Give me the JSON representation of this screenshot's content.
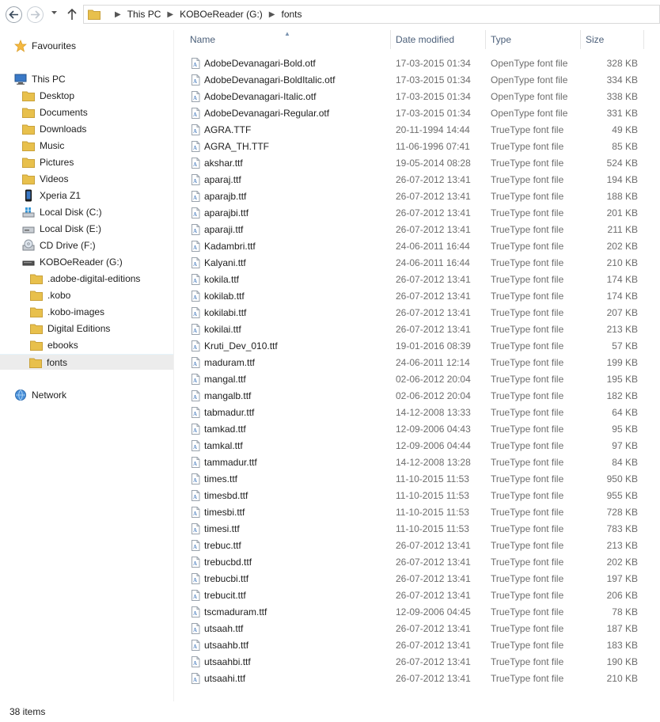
{
  "address": {
    "crumbs": [
      "This PC",
      "KOBOeReader (G:)",
      "fonts"
    ]
  },
  "nav": {
    "favourites": "Favourites",
    "this_pc": "This PC",
    "items": [
      {
        "label": "Desktop",
        "icon": "folder-icon"
      },
      {
        "label": "Documents",
        "icon": "folder-icon"
      },
      {
        "label": "Downloads",
        "icon": "folder-icon"
      },
      {
        "label": "Music",
        "icon": "folder-icon"
      },
      {
        "label": "Pictures",
        "icon": "folder-icon"
      },
      {
        "label": "Videos",
        "icon": "folder-icon"
      },
      {
        "label": "Xperia Z1",
        "icon": "phone-icon"
      },
      {
        "label": "Local Disk (C:)",
        "icon": "windows-drive-icon"
      },
      {
        "label": "Local Disk (E:)",
        "icon": "drive-icon"
      },
      {
        "label": "CD Drive (F:)",
        "icon": "cd-drive-icon"
      },
      {
        "label": "KOBOeReader (G:)",
        "icon": "removable-drive-icon"
      }
    ],
    "kobo_children": [
      {
        "label": ".adobe-digital-editions"
      },
      {
        "label": ".kobo"
      },
      {
        "label": ".kobo-images"
      },
      {
        "label": "Digital Editions"
      },
      {
        "label": "ebooks"
      },
      {
        "label": "fonts"
      }
    ],
    "network": "Network"
  },
  "columns": {
    "name": "Name",
    "date": "Date modified",
    "type": "Type",
    "size": "Size"
  },
  "files": [
    {
      "name": "AdobeDevanagari-Bold.otf",
      "date": "17-03-2015 01:34",
      "type": "OpenType font file",
      "size": "328 KB"
    },
    {
      "name": "AdobeDevanagari-BoldItalic.otf",
      "date": "17-03-2015 01:34",
      "type": "OpenType font file",
      "size": "334 KB"
    },
    {
      "name": "AdobeDevanagari-Italic.otf",
      "date": "17-03-2015 01:34",
      "type": "OpenType font file",
      "size": "338 KB"
    },
    {
      "name": "AdobeDevanagari-Regular.otf",
      "date": "17-03-2015 01:34",
      "type": "OpenType font file",
      "size": "331 KB"
    },
    {
      "name": "AGRA.TTF",
      "date": "20-11-1994 14:44",
      "type": "TrueType font file",
      "size": "49 KB"
    },
    {
      "name": "AGRA_TH.TTF",
      "date": "11-06-1996 07:41",
      "type": "TrueType font file",
      "size": "85 KB"
    },
    {
      "name": "akshar.ttf",
      "date": "19-05-2014 08:28",
      "type": "TrueType font file",
      "size": "524 KB"
    },
    {
      "name": "aparaj.ttf",
      "date": "26-07-2012 13:41",
      "type": "TrueType font file",
      "size": "194 KB"
    },
    {
      "name": "aparajb.ttf",
      "date": "26-07-2012 13:41",
      "type": "TrueType font file",
      "size": "188 KB"
    },
    {
      "name": "aparajbi.ttf",
      "date": "26-07-2012 13:41",
      "type": "TrueType font file",
      "size": "201 KB"
    },
    {
      "name": "aparaji.ttf",
      "date": "26-07-2012 13:41",
      "type": "TrueType font file",
      "size": "211 KB"
    },
    {
      "name": "Kadambri.ttf",
      "date": "24-06-2011 16:44",
      "type": "TrueType font file",
      "size": "202 KB"
    },
    {
      "name": "Kalyani.ttf",
      "date": "24-06-2011 16:44",
      "type": "TrueType font file",
      "size": "210 KB"
    },
    {
      "name": "kokila.ttf",
      "date": "26-07-2012 13:41",
      "type": "TrueType font file",
      "size": "174 KB"
    },
    {
      "name": "kokilab.ttf",
      "date": "26-07-2012 13:41",
      "type": "TrueType font file",
      "size": "174 KB"
    },
    {
      "name": "kokilabi.ttf",
      "date": "26-07-2012 13:41",
      "type": "TrueType font file",
      "size": "207 KB"
    },
    {
      "name": "kokilai.ttf",
      "date": "26-07-2012 13:41",
      "type": "TrueType font file",
      "size": "213 KB"
    },
    {
      "name": "Kruti_Dev_010.ttf",
      "date": "19-01-2016 08:39",
      "type": "TrueType font file",
      "size": "57 KB"
    },
    {
      "name": "maduram.ttf",
      "date": "24-06-2011 12:14",
      "type": "TrueType font file",
      "size": "199 KB"
    },
    {
      "name": "mangal.ttf",
      "date": "02-06-2012 20:04",
      "type": "TrueType font file",
      "size": "195 KB"
    },
    {
      "name": "mangalb.ttf",
      "date": "02-06-2012 20:04",
      "type": "TrueType font file",
      "size": "182 KB"
    },
    {
      "name": "tabmadur.ttf",
      "date": "14-12-2008 13:33",
      "type": "TrueType font file",
      "size": "64 KB"
    },
    {
      "name": "tamkad.ttf",
      "date": "12-09-2006 04:43",
      "type": "TrueType font file",
      "size": "95 KB"
    },
    {
      "name": "tamkal.ttf",
      "date": "12-09-2006 04:44",
      "type": "TrueType font file",
      "size": "97 KB"
    },
    {
      "name": "tammadur.ttf",
      "date": "14-12-2008 13:28",
      "type": "TrueType font file",
      "size": "84 KB"
    },
    {
      "name": "times.ttf",
      "date": "11-10-2015 11:53",
      "type": "TrueType font file",
      "size": "950 KB"
    },
    {
      "name": "timesbd.ttf",
      "date": "11-10-2015 11:53",
      "type": "TrueType font file",
      "size": "955 KB"
    },
    {
      "name": "timesbi.ttf",
      "date": "11-10-2015 11:53",
      "type": "TrueType font file",
      "size": "728 KB"
    },
    {
      "name": "timesi.ttf",
      "date": "11-10-2015 11:53",
      "type": "TrueType font file",
      "size": "783 KB"
    },
    {
      "name": "trebuc.ttf",
      "date": "26-07-2012 13:41",
      "type": "TrueType font file",
      "size": "213 KB"
    },
    {
      "name": "trebucbd.ttf",
      "date": "26-07-2012 13:41",
      "type": "TrueType font file",
      "size": "202 KB"
    },
    {
      "name": "trebucbi.ttf",
      "date": "26-07-2012 13:41",
      "type": "TrueType font file",
      "size": "197 KB"
    },
    {
      "name": "trebucit.ttf",
      "date": "26-07-2012 13:41",
      "type": "TrueType font file",
      "size": "206 KB"
    },
    {
      "name": "tscmaduram.ttf",
      "date": "12-09-2006 04:45",
      "type": "TrueType font file",
      "size": "78 KB"
    },
    {
      "name": "utsaah.ttf",
      "date": "26-07-2012 13:41",
      "type": "TrueType font file",
      "size": "187 KB"
    },
    {
      "name": "utsaahb.ttf",
      "date": "26-07-2012 13:41",
      "type": "TrueType font file",
      "size": "183 KB"
    },
    {
      "name": "utsaahbi.ttf",
      "date": "26-07-2012 13:41",
      "type": "TrueType font file",
      "size": "190 KB"
    },
    {
      "name": "utsaahi.ttf",
      "date": "26-07-2012 13:41",
      "type": "TrueType font file",
      "size": "210 KB"
    }
  ],
  "status": {
    "item_count": "38 items"
  },
  "colors": {
    "folder": "#e8c04c",
    "selected_bg": "#ececec",
    "header_text": "#4c607a",
    "detail_text": "#6d6d6d"
  }
}
